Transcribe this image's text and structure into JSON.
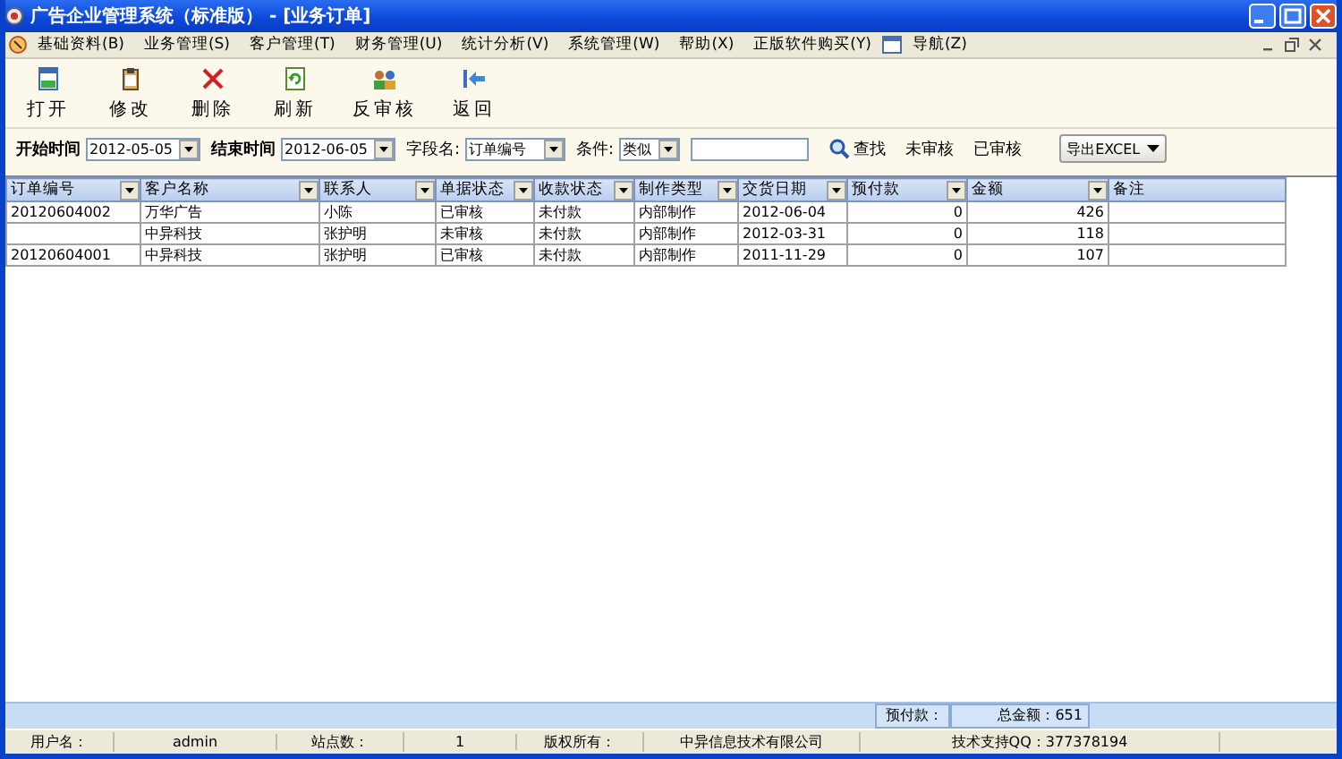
{
  "window": {
    "title": "广告企业管理系统（标准版） - [业务订单]"
  },
  "menu": [
    "基础资料(B)",
    "业务管理(S)",
    "客户管理(T)",
    "财务管理(U)",
    "统计分析(V)",
    "系统管理(W)",
    "帮助(X)",
    "正版软件购买(Y)",
    "导航(Z)"
  ],
  "toolbar": [
    {
      "label": "打开",
      "kind": "open"
    },
    {
      "label": "修改",
      "kind": "edit"
    },
    {
      "label": "删除",
      "kind": "delete"
    },
    {
      "label": "刷新",
      "kind": "refresh"
    },
    {
      "label": "反审核",
      "kind": "unaudit"
    },
    {
      "label": "返回",
      "kind": "back"
    }
  ],
  "filter": {
    "start_label": "开始时间",
    "start_value": "2012-05-05",
    "end_label": "结束时间",
    "end_value": "2012-06-05",
    "field_label": "字段名:",
    "field_value": "订单编号",
    "cond_label": "条件:",
    "cond_value": "类似",
    "search": "查找",
    "links": [
      "未审核",
      "已审核"
    ],
    "export": "导出EXCEL"
  },
  "table": {
    "columns": [
      {
        "label": "订单编号",
        "kind": "text"
      },
      {
        "label": "客户名称",
        "kind": "text"
      },
      {
        "label": "联系人",
        "kind": "text"
      },
      {
        "label": "单据状态",
        "kind": "text"
      },
      {
        "label": "收款状态",
        "kind": "text"
      },
      {
        "label": "制作类型",
        "kind": "text"
      },
      {
        "label": "交货日期",
        "kind": "text"
      },
      {
        "label": "预付款",
        "kind": "number"
      },
      {
        "label": "金额",
        "kind": "number"
      },
      {
        "label": "备注",
        "kind": "text"
      }
    ],
    "rows": [
      {
        "cells": [
          "20120604002",
          "万华广告",
          "小陈",
          "已审核",
          "未付款",
          "内部制作",
          "2012-06-04",
          "0",
          "426"
        ]
      },
      {
        "cells": [
          "",
          "中异科技",
          "张护明",
          "未审核",
          "未付款",
          "内部制作",
          "2012-03-31",
          "0",
          "118"
        ]
      },
      {
        "cells": [
          "20120604001",
          "中异科技",
          "张护明",
          "已审核",
          "未付款",
          "内部制作",
          "2011-11-29",
          "0",
          "107"
        ]
      }
    ]
  },
  "summary": [
    "预付款：",
    "总金额：651"
  ],
  "status_bar": [
    "用户名：",
    "admin",
    "站点数：",
    "1",
    "版权所有：",
    "中异信息技术有限公司",
    "技术支持QQ：377378194"
  ]
}
